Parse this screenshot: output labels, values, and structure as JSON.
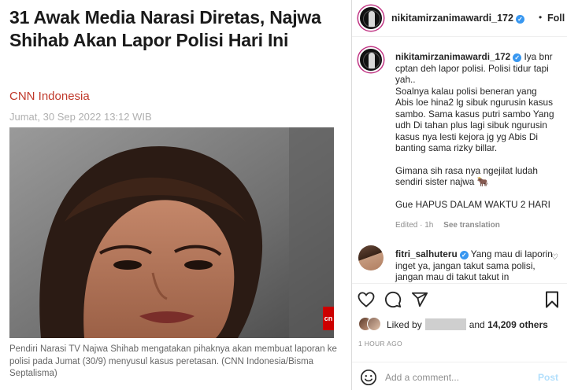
{
  "article": {
    "headline": "31 Awak Media Narasi Diretas, Najwa Shihab Akan Lapor Polisi Hari Ini",
    "source": "CNN Indonesia",
    "date": "Jumat, 30 Sep 2022 13:12 WIB",
    "caption": "Pendiri Narasi TV Najwa Shihab mengatakan pihaknya akan membuat laporan ke polisi pada Jumat (30/9) menyusul kasus peretasan. (CNN Indonesia/Bisma Septalisma)",
    "photo_badge": "cn"
  },
  "post": {
    "username": "nikitamirzanimawardi_172",
    "follow_label": "Foll",
    "separator": "•",
    "caption": {
      "username": "nikitamirzanimawardi_172",
      "lines": [
        "Iya bnr cptan deh lapor polisi. Polisi tidur tapi yah..",
        "Soalnya kalau polisi beneran yang Abis loe hina2 lg sibuk ngurusin kasus sambo. Sama kasus putri sambo Yang udh Di tahan plus lagi sibuk ngurusin kasus nya lesti kejora jg yg Abis Di banting sama rizky billar.",
        "Gimana sih rasa nya ngejilat ludah sendiri sister najwa 🐂",
        "Gue HAPUS DALAM WAKTU 2 HARI"
      ],
      "edited": "Edited · 1h",
      "see_translation": "See translation"
    },
    "comment": {
      "username": "fitri_salhuteru",
      "text": "Yang mau di laporin inget ya, jangan takut sama polisi, jangan mau di takut takut in"
    },
    "likes": {
      "prefix": "Liked by",
      "and_text": "and",
      "count": "14,209 others"
    },
    "time_ago": "1 HOUR AGO",
    "add_comment_placeholder": "Add a comment...",
    "post_label": "Post"
  },
  "colors": {
    "source_red": "#c0392b",
    "verified_blue": "#3897f0",
    "post_disabled": "#b2dffc"
  },
  "icons": [
    "heart-icon",
    "comment-icon",
    "share-icon",
    "bookmark-icon",
    "emoji-icon",
    "verified-icon",
    "more-icon"
  ]
}
